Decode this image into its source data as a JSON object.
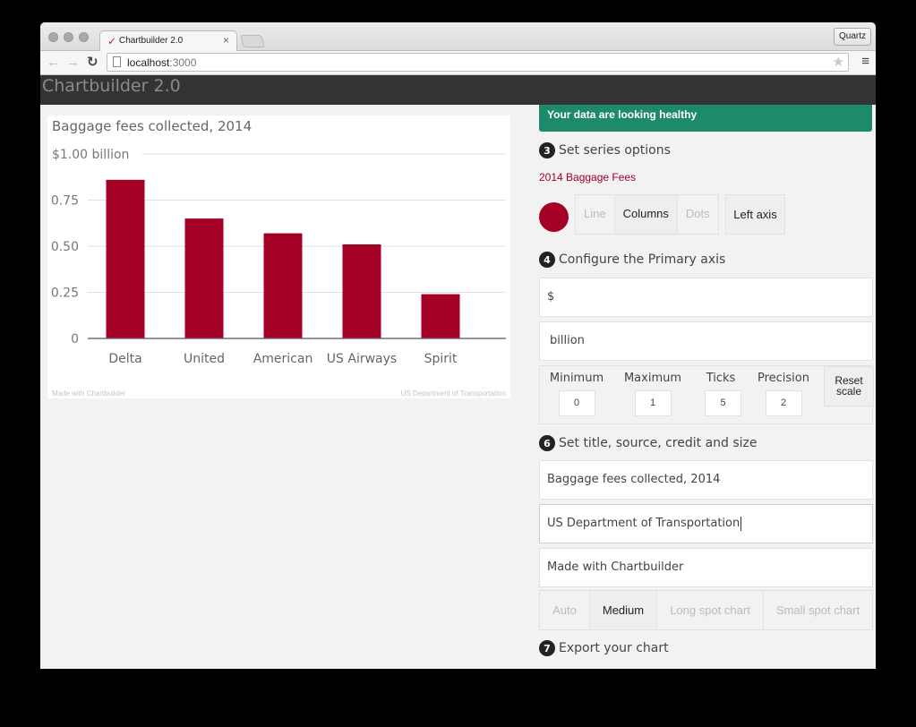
{
  "browser": {
    "tab_title": "Chartbuilder 2.0",
    "profile_button": "Quartz",
    "url_host": "localhost",
    "url_port": ":3000"
  },
  "app": {
    "title": "Chartbuilder 2.0"
  },
  "chart": {
    "title": "Baggage fees collected, 2014",
    "credit": "Made with Chartbuilder",
    "source": "US Department of Transportation"
  },
  "chart_data": {
    "type": "bar",
    "title": "Baggage fees collected, 2014",
    "categories": [
      "Delta",
      "United",
      "American",
      "US Airways",
      "Spirit"
    ],
    "series": [
      {
        "name": "2014 Baggage Fees",
        "color": "#a50026",
        "values": [
          0.86,
          0.65,
          0.57,
          0.51,
          0.24
        ]
      }
    ],
    "ylim": [
      0,
      1
    ],
    "yticks": [
      0,
      0.25,
      0.5,
      0.75,
      1
    ],
    "ytick_labels": [
      "0",
      "0.25",
      "0.50",
      "0.75",
      "$1.00 billion"
    ],
    "xlabel": "",
    "ylabel": "",
    "grid": true,
    "credit": "Made with Chartbuilder",
    "source": "US Department of Transportation"
  },
  "panel": {
    "health_message": "Your data are looking healthy",
    "step3": {
      "num": "3",
      "label": "Set series options"
    },
    "series_name": "2014 Baggage Fees",
    "series_color": "#a50026",
    "type_options": [
      "Line",
      "Columns",
      "Dots"
    ],
    "type_selected": "Columns",
    "axis_button": "Left axis",
    "step4": {
      "num": "4",
      "label": "Configure the Primary axis"
    },
    "axis_prefix": "$",
    "axis_suffix": "billion",
    "scale": {
      "min_label": "Minimum",
      "min_value": "0",
      "max_label": "Maximum",
      "max_value": "1",
      "ticks_label": "Ticks",
      "ticks_value": "5",
      "precision_label": "Precision",
      "precision_value": "2",
      "reset_label_1": "Reset",
      "reset_label_2": "scale"
    },
    "step6": {
      "num": "6",
      "label": "Set title, source, credit and size"
    },
    "title_value": "Baggage fees collected, 2014",
    "source_value": "US Department of Transportation",
    "credit_value": "Made with Chartbuilder",
    "size_options": [
      "Auto",
      "Medium",
      "Long spot chart",
      "Small spot chart"
    ],
    "size_selected": "Medium",
    "step7": {
      "num": "7",
      "label": "Export your chart"
    }
  }
}
